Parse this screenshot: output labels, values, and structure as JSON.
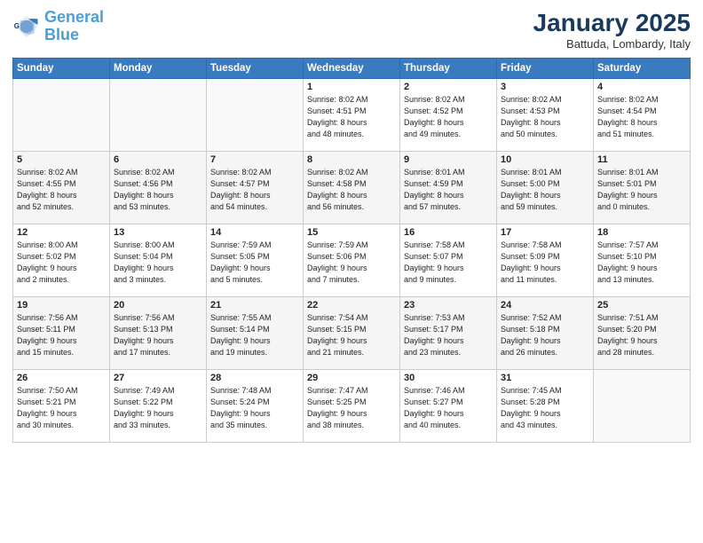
{
  "header": {
    "logo_line1": "General",
    "logo_line2": "Blue",
    "month": "January 2025",
    "location": "Battuda, Lombardy, Italy"
  },
  "weekdays": [
    "Sunday",
    "Monday",
    "Tuesday",
    "Wednesday",
    "Thursday",
    "Friday",
    "Saturday"
  ],
  "weeks": [
    [
      {
        "day": "",
        "info": ""
      },
      {
        "day": "",
        "info": ""
      },
      {
        "day": "",
        "info": ""
      },
      {
        "day": "1",
        "info": "Sunrise: 8:02 AM\nSunset: 4:51 PM\nDaylight: 8 hours\nand 48 minutes."
      },
      {
        "day": "2",
        "info": "Sunrise: 8:02 AM\nSunset: 4:52 PM\nDaylight: 8 hours\nand 49 minutes."
      },
      {
        "day": "3",
        "info": "Sunrise: 8:02 AM\nSunset: 4:53 PM\nDaylight: 8 hours\nand 50 minutes."
      },
      {
        "day": "4",
        "info": "Sunrise: 8:02 AM\nSunset: 4:54 PM\nDaylight: 8 hours\nand 51 minutes."
      }
    ],
    [
      {
        "day": "5",
        "info": "Sunrise: 8:02 AM\nSunset: 4:55 PM\nDaylight: 8 hours\nand 52 minutes."
      },
      {
        "day": "6",
        "info": "Sunrise: 8:02 AM\nSunset: 4:56 PM\nDaylight: 8 hours\nand 53 minutes."
      },
      {
        "day": "7",
        "info": "Sunrise: 8:02 AM\nSunset: 4:57 PM\nDaylight: 8 hours\nand 54 minutes."
      },
      {
        "day": "8",
        "info": "Sunrise: 8:02 AM\nSunset: 4:58 PM\nDaylight: 8 hours\nand 56 minutes."
      },
      {
        "day": "9",
        "info": "Sunrise: 8:01 AM\nSunset: 4:59 PM\nDaylight: 8 hours\nand 57 minutes."
      },
      {
        "day": "10",
        "info": "Sunrise: 8:01 AM\nSunset: 5:00 PM\nDaylight: 8 hours\nand 59 minutes."
      },
      {
        "day": "11",
        "info": "Sunrise: 8:01 AM\nSunset: 5:01 PM\nDaylight: 9 hours\nand 0 minutes."
      }
    ],
    [
      {
        "day": "12",
        "info": "Sunrise: 8:00 AM\nSunset: 5:02 PM\nDaylight: 9 hours\nand 2 minutes."
      },
      {
        "day": "13",
        "info": "Sunrise: 8:00 AM\nSunset: 5:04 PM\nDaylight: 9 hours\nand 3 minutes."
      },
      {
        "day": "14",
        "info": "Sunrise: 7:59 AM\nSunset: 5:05 PM\nDaylight: 9 hours\nand 5 minutes."
      },
      {
        "day": "15",
        "info": "Sunrise: 7:59 AM\nSunset: 5:06 PM\nDaylight: 9 hours\nand 7 minutes."
      },
      {
        "day": "16",
        "info": "Sunrise: 7:58 AM\nSunset: 5:07 PM\nDaylight: 9 hours\nand 9 minutes."
      },
      {
        "day": "17",
        "info": "Sunrise: 7:58 AM\nSunset: 5:09 PM\nDaylight: 9 hours\nand 11 minutes."
      },
      {
        "day": "18",
        "info": "Sunrise: 7:57 AM\nSunset: 5:10 PM\nDaylight: 9 hours\nand 13 minutes."
      }
    ],
    [
      {
        "day": "19",
        "info": "Sunrise: 7:56 AM\nSunset: 5:11 PM\nDaylight: 9 hours\nand 15 minutes."
      },
      {
        "day": "20",
        "info": "Sunrise: 7:56 AM\nSunset: 5:13 PM\nDaylight: 9 hours\nand 17 minutes."
      },
      {
        "day": "21",
        "info": "Sunrise: 7:55 AM\nSunset: 5:14 PM\nDaylight: 9 hours\nand 19 minutes."
      },
      {
        "day": "22",
        "info": "Sunrise: 7:54 AM\nSunset: 5:15 PM\nDaylight: 9 hours\nand 21 minutes."
      },
      {
        "day": "23",
        "info": "Sunrise: 7:53 AM\nSunset: 5:17 PM\nDaylight: 9 hours\nand 23 minutes."
      },
      {
        "day": "24",
        "info": "Sunrise: 7:52 AM\nSunset: 5:18 PM\nDaylight: 9 hours\nand 26 minutes."
      },
      {
        "day": "25",
        "info": "Sunrise: 7:51 AM\nSunset: 5:20 PM\nDaylight: 9 hours\nand 28 minutes."
      }
    ],
    [
      {
        "day": "26",
        "info": "Sunrise: 7:50 AM\nSunset: 5:21 PM\nDaylight: 9 hours\nand 30 minutes."
      },
      {
        "day": "27",
        "info": "Sunrise: 7:49 AM\nSunset: 5:22 PM\nDaylight: 9 hours\nand 33 minutes."
      },
      {
        "day": "28",
        "info": "Sunrise: 7:48 AM\nSunset: 5:24 PM\nDaylight: 9 hours\nand 35 minutes."
      },
      {
        "day": "29",
        "info": "Sunrise: 7:47 AM\nSunset: 5:25 PM\nDaylight: 9 hours\nand 38 minutes."
      },
      {
        "day": "30",
        "info": "Sunrise: 7:46 AM\nSunset: 5:27 PM\nDaylight: 9 hours\nand 40 minutes."
      },
      {
        "day": "31",
        "info": "Sunrise: 7:45 AM\nSunset: 5:28 PM\nDaylight: 9 hours\nand 43 minutes."
      },
      {
        "day": "",
        "info": ""
      }
    ]
  ]
}
